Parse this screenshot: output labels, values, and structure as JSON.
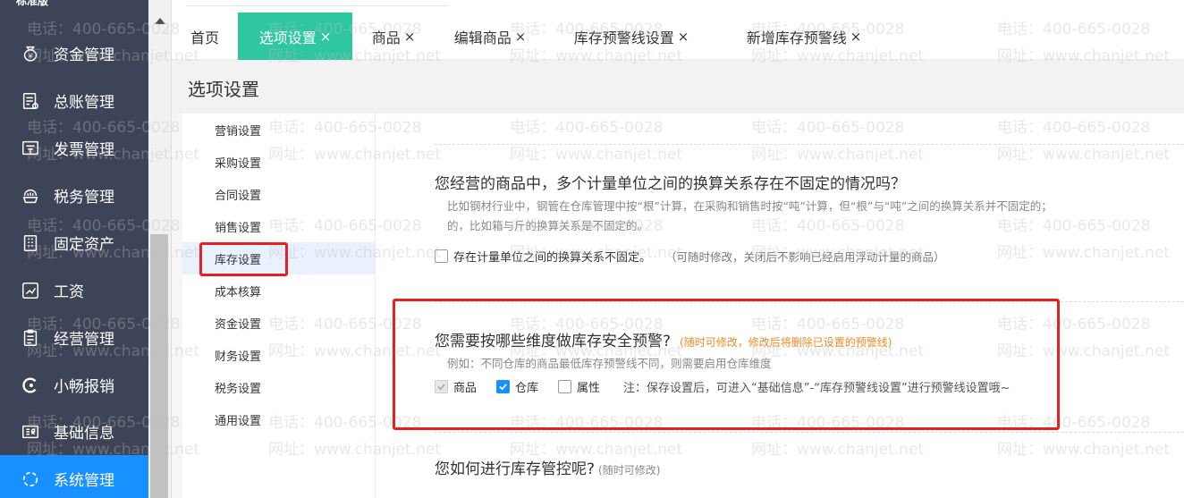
{
  "sidebar": {
    "brand": "标准版",
    "items": [
      {
        "label": "资金管理",
        "icon": "money-bag-icon"
      },
      {
        "label": "总账管理",
        "icon": "ledger-icon"
      },
      {
        "label": "发票管理",
        "icon": "invoice-icon"
      },
      {
        "label": "税务管理",
        "icon": "tax-icon"
      },
      {
        "label": "固定资产",
        "icon": "building-icon"
      },
      {
        "label": "工资",
        "icon": "salary-chart-icon"
      },
      {
        "label": "经营管理",
        "icon": "clipboard-icon"
      },
      {
        "label": "小畅报销",
        "icon": "reimburse-icon"
      },
      {
        "label": "基础信息",
        "icon": "info-card-icon"
      },
      {
        "label": "系统管理",
        "icon": "system-icon",
        "active": true
      }
    ]
  },
  "tabs": [
    {
      "label": "首页",
      "closable": false
    },
    {
      "label": "选项设置",
      "closable": true,
      "active": true
    },
    {
      "label": "商品",
      "closable": true
    },
    {
      "label": "编辑商品",
      "closable": true
    },
    {
      "label": "库存预警线设置",
      "closable": true
    },
    {
      "label": "新增库存预警线",
      "closable": true
    }
  ],
  "close_glyph": "×",
  "page_title": "选项设置",
  "settings_nav": [
    {
      "label": "营销设置"
    },
    {
      "label": "采购设置"
    },
    {
      "label": "合同设置"
    },
    {
      "label": "销售设置"
    },
    {
      "label": "库存设置",
      "active": true
    },
    {
      "label": "成本核算"
    },
    {
      "label": "资金设置"
    },
    {
      "label": "财务设置"
    },
    {
      "label": "税务设置"
    },
    {
      "label": "通用设置"
    }
  ],
  "sections": {
    "unit": {
      "title": "您经营的商品中，多个计量单位之间的换算关系存在不固定的情况吗？",
      "desc_line1": "比如钢材行业中，钢管在仓库管理中按“根”计算，在采购和销售时按“吨”计算，但“根”与“吨”之间的换算关系并不固定的；",
      "desc_line2": "的，比如箱与斤的换算关系是不固定的。",
      "option_label": "存在计量单位之间的换算关系不固定。",
      "option_note": "（可随时修改，关闭后不影响已经启用浮动计量的商品）",
      "checked": false
    },
    "alert": {
      "title": "您需要按哪些维度做库存安全预警?",
      "hint": "(随时可修改，修改后将删除已设置的预警线)",
      "desc": "例如：不同仓库的商品最低库存预警线不同，则需要启用仓库维度",
      "options": [
        {
          "label": "商品",
          "state": "disabled-checked"
        },
        {
          "label": "仓库",
          "state": "checked"
        },
        {
          "label": "属性",
          "state": "unchecked"
        }
      ],
      "note": "注：保存设置后，可进入“基础信息”-“库存预警线设置”进行预警线设置哦~"
    },
    "control": {
      "title": "您如何进行库存管控呢?",
      "hint": "(随时可修改)"
    }
  },
  "watermark": {
    "phone": "电话：400-665-0028",
    "site": "网址：www.chanjet.net"
  },
  "colors": {
    "sidebar_bg": "#3e4458",
    "sidebar_active": "#1890ff",
    "tab_active": "#2fc7a2",
    "hint_orange": "#f08a24",
    "annotation_red": "#e5201f"
  }
}
